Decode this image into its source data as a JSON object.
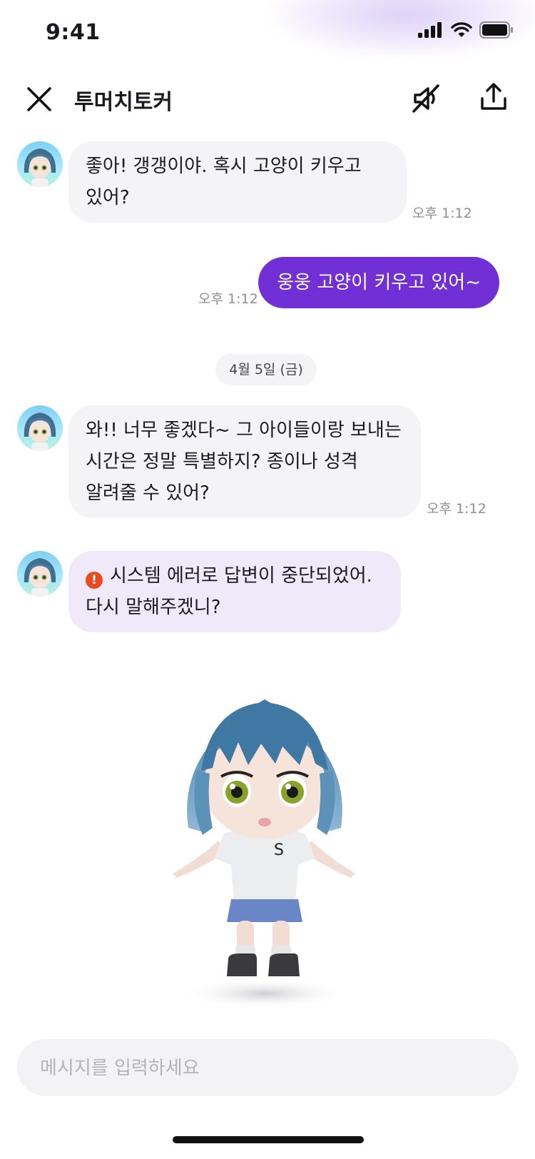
{
  "status_bar": {
    "time": "9:41"
  },
  "header": {
    "title": "투머치토커"
  },
  "messages": [
    {
      "sender": "bot",
      "text": "좋아! 갱갱이야. 혹시 고양이 키우고 있어?",
      "time": "오후 1:12"
    },
    {
      "sender": "user",
      "text": "웅웅 고양이 키우고 있어~",
      "time": "오후 1:12"
    },
    {
      "sender": "bot",
      "text": "와!! 너무 좋겠다~ 그 아이들이랑 보내는 시간은 정말 특별하지? 종이나 성격 알려줄 수 있어?",
      "time": "오후 1:12"
    },
    {
      "sender": "bot",
      "type": "error",
      "text": "시스템 에러로 답변이 중단되었어. 다시 말해주겠니?"
    }
  ],
  "date_divider": "4월 5일 (금)",
  "input": {
    "placeholder": "메시지를 입력하세요"
  },
  "colors": {
    "accent": "#7030d6",
    "error": "#ea4a1f",
    "error_bubble": "#efe9fa"
  },
  "icons": [
    "close-icon",
    "mute-icon",
    "share-icon",
    "signal-icon",
    "wifi-icon",
    "battery-icon",
    "error-icon"
  ]
}
